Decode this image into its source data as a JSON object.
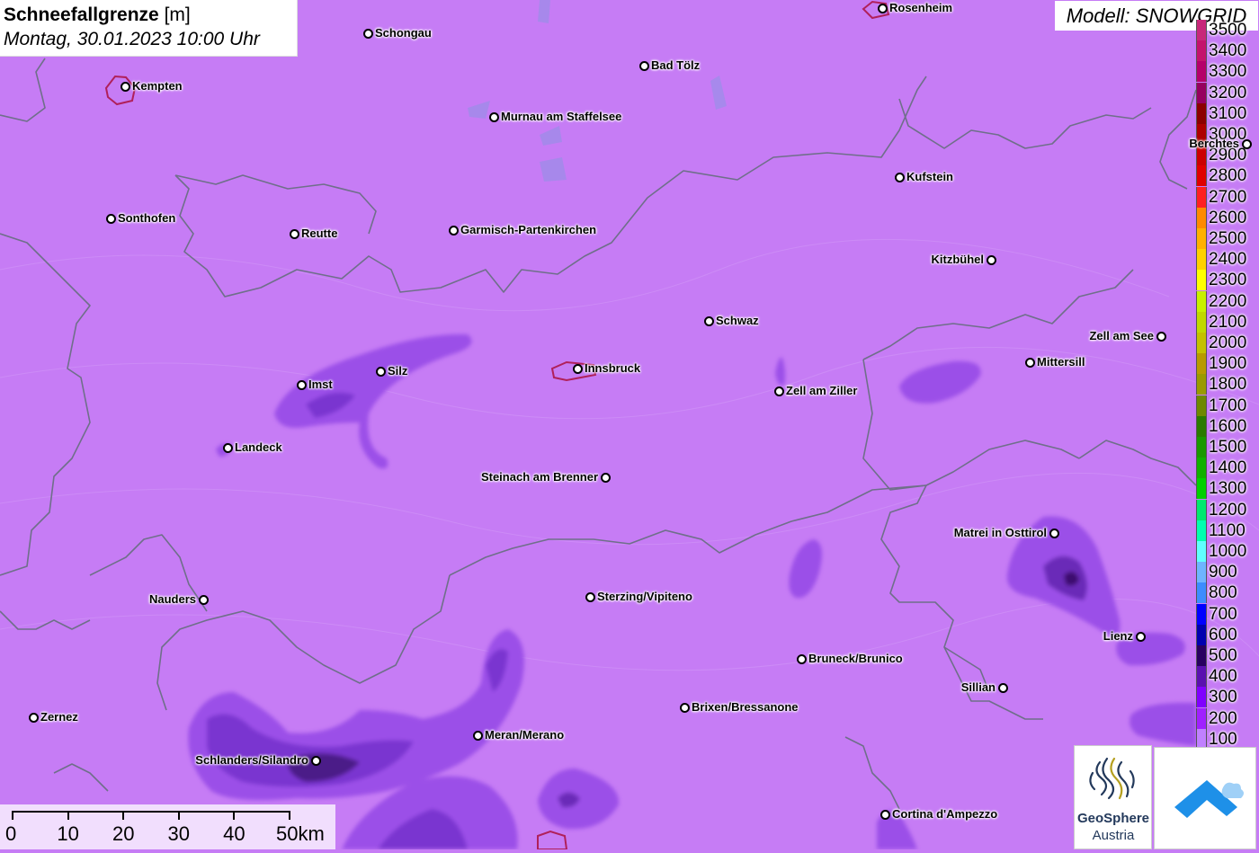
{
  "title": {
    "main": "Schneefallgrenze",
    "unit": "[m]",
    "date": "Montag, 30.01.2023 10:00 Uhr"
  },
  "model": "Modell: SNOWGRID",
  "legend": {
    "levels": [
      {
        "label": "3500",
        "color": "#c8287a"
      },
      {
        "label": "3400",
        "color": "#c4136c"
      },
      {
        "label": "3300",
        "color": "#b5006a"
      },
      {
        "label": "3200",
        "color": "#960060"
      },
      {
        "label": "3100",
        "color": "#8c0000"
      },
      {
        "label": "3000",
        "color": "#ad0000"
      },
      {
        "label": "2900",
        "color": "#cc0000"
      },
      {
        "label": "2800",
        "color": "#e00000"
      },
      {
        "label": "2700",
        "color": "#ff2020"
      },
      {
        "label": "2600",
        "color": "#ff8a00"
      },
      {
        "label": "2500",
        "color": "#ffb000"
      },
      {
        "label": "2400",
        "color": "#ffd000"
      },
      {
        "label": "2300",
        "color": "#ffff00"
      },
      {
        "label": "2200",
        "color": "#c8f000"
      },
      {
        "label": "2100",
        "color": "#c0d800"
      },
      {
        "label": "2000",
        "color": "#c4c000"
      },
      {
        "label": "1900",
        "color": "#b89a00"
      },
      {
        "label": "1800",
        "color": "#9a9a00"
      },
      {
        "label": "1700",
        "color": "#6e8800"
      },
      {
        "label": "1600",
        "color": "#2a7a00"
      },
      {
        "label": "1500",
        "color": "#1a9800"
      },
      {
        "label": "1400",
        "color": "#10b000"
      },
      {
        "label": "1300",
        "color": "#00d000"
      },
      {
        "label": "1200",
        "color": "#00e870"
      },
      {
        "label": "1100",
        "color": "#00ffb0"
      },
      {
        "label": "1000",
        "color": "#60ffff"
      },
      {
        "label": "900",
        "color": "#6eb4ff"
      },
      {
        "label": "800",
        "color": "#3c8cff"
      },
      {
        "label": "700",
        "color": "#0000ff"
      },
      {
        "label": "600",
        "color": "#0000b0"
      },
      {
        "label": "500",
        "color": "#280060"
      },
      {
        "label": "400",
        "color": "#5a10b0"
      },
      {
        "label": "300",
        "color": "#8000ff"
      },
      {
        "label": "200",
        "color": "#a020ff"
      },
      {
        "label": "100",
        "color": "#c080ff"
      }
    ]
  },
  "cities": [
    {
      "name": "Schongau",
      "label_side": "right"
    },
    {
      "name": "Rosenheim",
      "label_side": "right"
    },
    {
      "name": "Kempten",
      "label_side": "right"
    },
    {
      "name": "Bad Tölz",
      "label_side": "right"
    },
    {
      "name": "Murnau am Staffelsee",
      "label_side": "right"
    },
    {
      "name": "Berchtes",
      "label_side": "left"
    },
    {
      "name": "Kufstein",
      "label_side": "right"
    },
    {
      "name": "Sonthofen",
      "label_side": "right"
    },
    {
      "name": "Reutte",
      "label_side": "right"
    },
    {
      "name": "Garmisch-Partenkirchen",
      "label_side": "right"
    },
    {
      "name": "Kitzbühel",
      "label_side": "left"
    },
    {
      "name": "Schwaz",
      "label_side": "right"
    },
    {
      "name": "Zell am See",
      "label_side": "left"
    },
    {
      "name": "Mittersill",
      "label_side": "right"
    },
    {
      "name": "Silz",
      "label_side": "right"
    },
    {
      "name": "Innsbruck",
      "label_side": "right"
    },
    {
      "name": "Imst",
      "label_side": "right"
    },
    {
      "name": "Zell am Ziller",
      "label_side": "right"
    },
    {
      "name": "Landeck",
      "label_side": "right"
    },
    {
      "name": "Steinach am Brenner",
      "label_side": "left"
    },
    {
      "name": "Matrei in Osttirol",
      "label_side": "left"
    },
    {
      "name": "Nauders",
      "label_side": "left"
    },
    {
      "name": "Sterzing/Vipiteno",
      "label_side": "right"
    },
    {
      "name": "Lienz",
      "label_side": "left"
    },
    {
      "name": "Bruneck/Brunico",
      "label_side": "right"
    },
    {
      "name": "Sillian",
      "label_side": "left"
    },
    {
      "name": "Brixen/Bressanone",
      "label_side": "right"
    },
    {
      "name": "Zernez",
      "label_side": "right"
    },
    {
      "name": "Meran/Merano",
      "label_side": "right"
    },
    {
      "name": "Schlanders/Silandro",
      "label_side": "left"
    },
    {
      "name": "Cortina d'Ampezzo",
      "label_side": "right"
    }
  ],
  "scale": {
    "labels": [
      "0",
      "10",
      "20",
      "30",
      "40",
      "50km"
    ]
  },
  "logos": {
    "geosphere_line1": "GeoSphere",
    "geosphere_line2": "Austria"
  },
  "colors": {
    "background": "#c67cf5",
    "snow_300": "#9b4fe8",
    "snow_200": "#8a3fe0",
    "snow_dark": "#5a1e9e",
    "border": "#6f6f8a"
  }
}
